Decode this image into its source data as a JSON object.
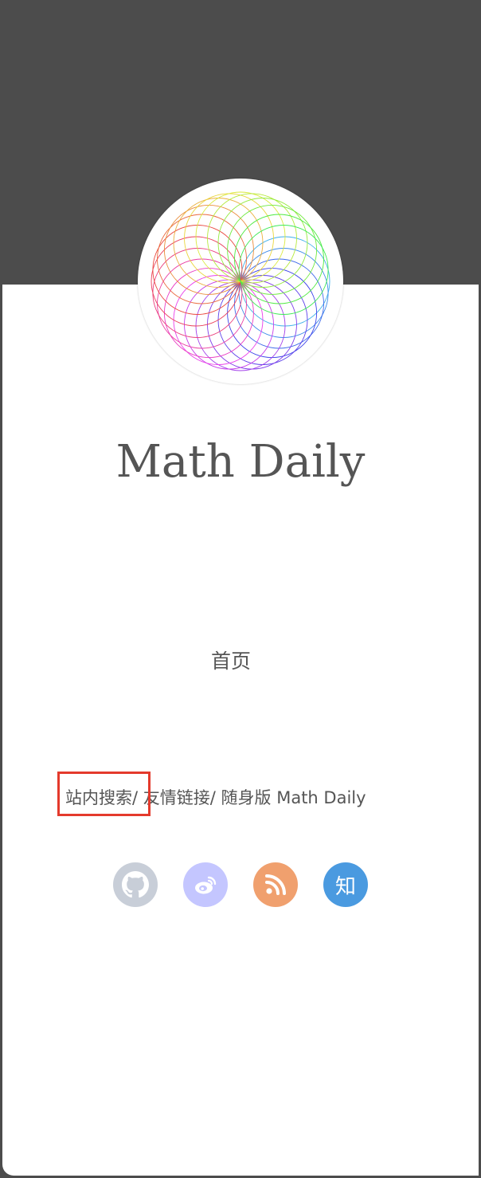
{
  "site": {
    "title": "Math Daily"
  },
  "nav": {
    "home": "首页"
  },
  "links": {
    "search": "站内搜索",
    "friends": "友情链接",
    "mobile": "随身版 Math Daily",
    "separator": "/"
  },
  "social": [
    {
      "name": "github",
      "icon": "github-icon",
      "color": "#c8ced8"
    },
    {
      "name": "weibo",
      "icon": "weibo-icon",
      "color": "#c4c6ff"
    },
    {
      "name": "rss",
      "icon": "rss-icon",
      "color": "#f0a06e"
    },
    {
      "name": "zhihu",
      "icon": "zhihu-icon",
      "label": "知",
      "color": "#4a9ae0"
    }
  ],
  "theme": {
    "header_bg": "#4c4c4c",
    "panel_bg": "#ffffff",
    "text_color": "#555555",
    "highlight_border": "#e43a2c"
  }
}
